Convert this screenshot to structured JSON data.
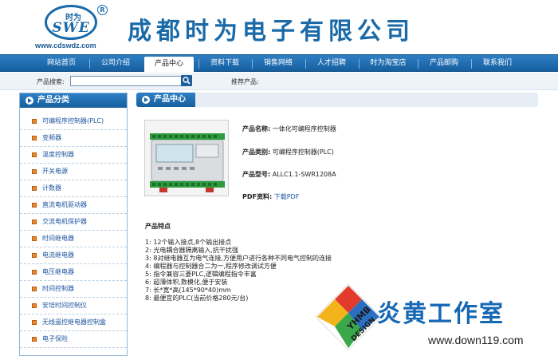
{
  "header": {
    "logo_cn": "时为",
    "logo_en": "SWE",
    "logo_reg": "R",
    "logo_url": "www.cdswdz.com",
    "company_name": "成都时为电子有限公司"
  },
  "nav": {
    "items": [
      {
        "label": "网站首页"
      },
      {
        "label": "公司介绍"
      },
      {
        "label": "产品中心",
        "active": true
      },
      {
        "label": "资料下载"
      },
      {
        "label": "销售网络"
      },
      {
        "label": "人才招聘"
      },
      {
        "label": "时为淘宝店"
      },
      {
        "label": "产品邮购"
      },
      {
        "label": "联系我们"
      }
    ]
  },
  "search": {
    "label": "产品搜索:",
    "value": "",
    "hot_label": "推荐产品:"
  },
  "sidebar": {
    "title": "产品分类",
    "items": [
      {
        "label": "可编程序控制器(PLC)"
      },
      {
        "label": "变频器"
      },
      {
        "label": "温度控制器"
      },
      {
        "label": "开关电源"
      },
      {
        "label": "计数器"
      },
      {
        "label": "直流电机驱动器"
      },
      {
        "label": "交流电机保护器"
      },
      {
        "label": "时间继电器"
      },
      {
        "label": "电流继电器"
      },
      {
        "label": "电压继电器"
      },
      {
        "label": "时间控制器"
      },
      {
        "label": "安培时间控制仪"
      },
      {
        "label": "无线遥控继电器控制盒"
      },
      {
        "label": "电子保险"
      }
    ]
  },
  "main": {
    "title": "产品中心",
    "fields": {
      "name_label": "产品名称:",
      "name_value": "一体化可编程序控制器",
      "category_label": "产品类别:",
      "category_value": "可编程序控制器(PLC)",
      "model_label": "产品型号:",
      "model_value": "ALLC1.1-SWR1208A",
      "pdf_label": "PDF资料:",
      "pdf_link": "下载PDF"
    },
    "features_title": "产品特点",
    "features": [
      "1:  12个输入接点,8个输出接点",
      "2:  光电耦合器隔离输入,抗干扰强",
      "3:  8对继电器互为电气连接,方便用户进行各种不同电气控制的连接",
      "4:  编程器与控制器合二为一,程序修改调试方便",
      "5:  指令兼容三菱PLC,逻辑编程指令丰富",
      "6:  超薄体积,数模化,便于安装",
      "7:  长*宽*高(145*90*40)mm",
      "8:  最便宜的PLC(当前价格280元/台)"
    ]
  },
  "watermark": {
    "brand": "炎黄工作室",
    "url": "www.down119.com",
    "logo_text": "YHMB DESIGN"
  },
  "colors": {
    "brand_blue": "#1a6aa8",
    "nav_blue": "#1d67a8",
    "bullet_orange": "#e8862c",
    "link_blue": "#1f55a0"
  }
}
